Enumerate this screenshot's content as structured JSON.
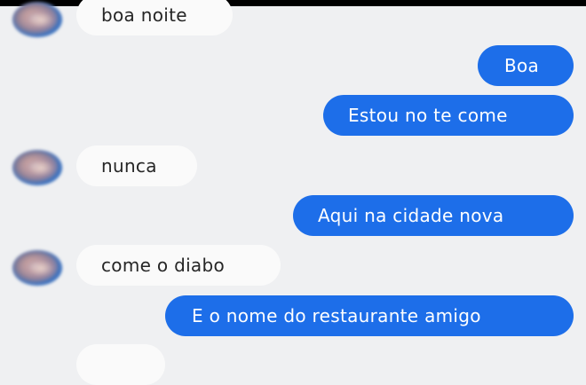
{
  "messages": [
    {
      "side": "incoming",
      "text": "boa noite"
    },
    {
      "side": "outgoing",
      "text": "Boa"
    },
    {
      "side": "outgoing",
      "text": "Estou no te come"
    },
    {
      "side": "incoming",
      "text": "nunca"
    },
    {
      "side": "outgoing",
      "text": "Aqui na cidade nova"
    },
    {
      "side": "incoming",
      "text": "come o diabo"
    },
    {
      "side": "outgoing",
      "text": "E o nome do restaurante amigo"
    }
  ],
  "colors": {
    "background": "#eff0f2",
    "incoming_bubble": "#fafafa",
    "outgoing_bubble": "#1d6ee9"
  },
  "icons": {
    "avatar": "contact-avatar-blurred"
  }
}
